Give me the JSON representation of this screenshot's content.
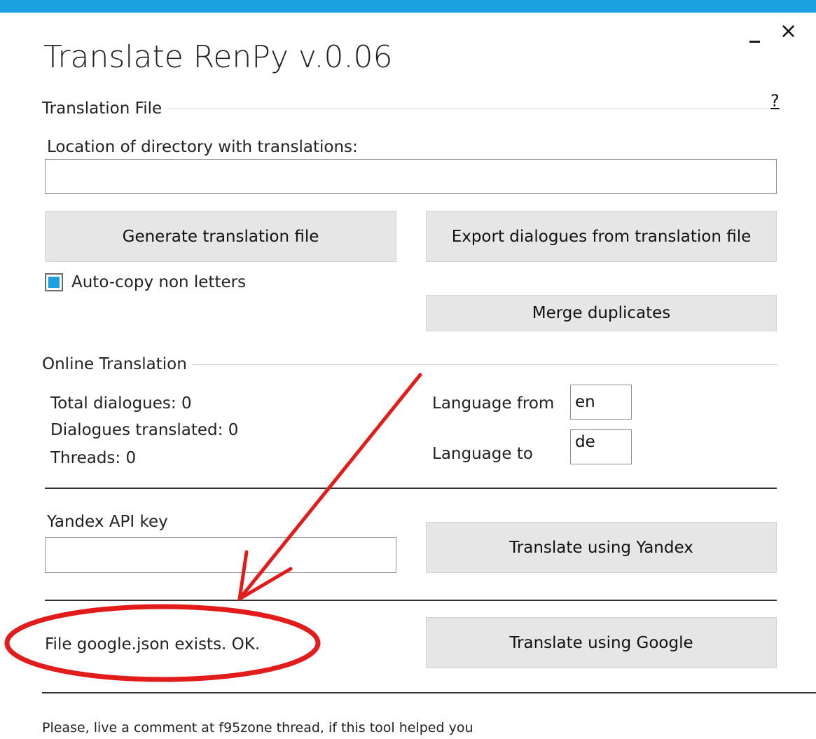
{
  "window": {
    "title": "Translate RenPy  v.0.06",
    "minimize_glyph": "_",
    "close_glyph": "×",
    "accent_color": "#1ba1e2"
  },
  "translation_file": {
    "section_label": "Translation File",
    "help_link": "?",
    "directory_label": "Location of directory with translations:",
    "directory_value": "",
    "generate_button": "Generate translation file",
    "export_button": "Export dialogues from translation file",
    "autocopy_label": "Auto-copy non letters",
    "autocopy_checked": true,
    "merge_button": "Merge duplicates"
  },
  "online_translation": {
    "section_label": "Online Translation",
    "total_dialogues": "Total dialogues: 0",
    "dialogues_translated": "Dialogues translated: 0",
    "threads": "Threads: 0",
    "language_from_label": "Language from",
    "language_from_value": "en",
    "language_to_label": "Language to",
    "language_to_value": "de"
  },
  "yandex": {
    "api_key_label": "Yandex API key",
    "api_key_value": "",
    "translate_button": "Translate using Yandex"
  },
  "google": {
    "status_text": "File google.json exists. OK.",
    "translate_button": "Translate using Google"
  },
  "footer": {
    "text": "Please, live a comment at f95zone thread, if this tool helped you"
  },
  "annotation": {
    "color": "#e21b1b",
    "icons": [
      "red-arrow-icon",
      "red-ellipse-icon"
    ]
  }
}
